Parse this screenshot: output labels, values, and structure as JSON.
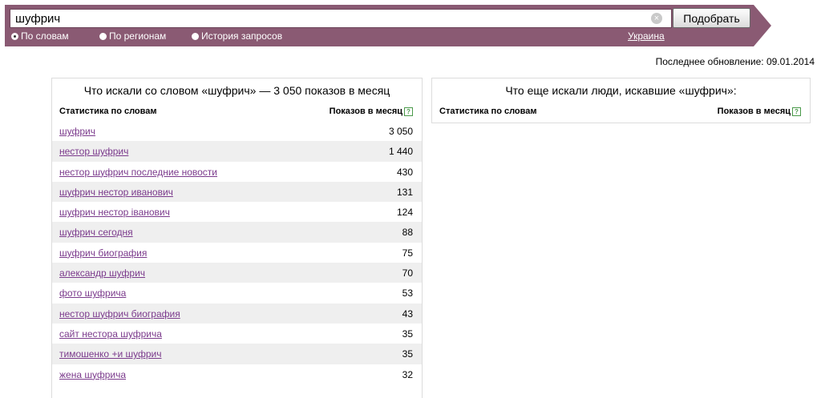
{
  "search": {
    "query": "шуфрич",
    "clear_glyph": "⊗",
    "submit_label": "Подобрать"
  },
  "modes": [
    {
      "label": "По словам",
      "checked": true
    },
    {
      "label": "По регионам",
      "checked": false
    },
    {
      "label": "История запросов",
      "checked": false
    }
  ],
  "region": "Украина",
  "last_update": "Последнее обновление: 09.01.2014",
  "left_panel": {
    "title": "Что искали со словом «шуфрич» — 3 050 показов в месяц",
    "col_words": "Статистика по словам",
    "col_shows": "Показов в месяц",
    "help_glyph": "?",
    "rows": [
      {
        "keyword": "шуфрич",
        "count": "3 050"
      },
      {
        "keyword": "нестор шуфрич",
        "count": "1 440"
      },
      {
        "keyword": "нестор шуфрич последние новости",
        "count": "430"
      },
      {
        "keyword": "шуфрич нестор иванович",
        "count": "131"
      },
      {
        "keyword": "шуфрич нестор іванович",
        "count": "124"
      },
      {
        "keyword": "шуфрич сегодня",
        "count": "88"
      },
      {
        "keyword": "шуфрич биография",
        "count": "75"
      },
      {
        "keyword": "александр шуфрич",
        "count": "70"
      },
      {
        "keyword": "фото шуфрича",
        "count": "53"
      },
      {
        "keyword": "нестор шуфрич биография",
        "count": "43"
      },
      {
        "keyword": "сайт нестора шуфрича",
        "count": "35"
      },
      {
        "keyword": "тимошенко +и шуфрич",
        "count": "35"
      },
      {
        "keyword": "жена шуфрича",
        "count": "32"
      }
    ]
  },
  "right_panel": {
    "title": "Что еще искали люди, искавшие «шуфрич»:",
    "col_words": "Статистика по словам",
    "col_shows": "Показов в месяц",
    "help_glyph": "?"
  },
  "colors": {
    "bar": "#8a5a73",
    "link": "#7b3a8c",
    "row_alt": "#efefef"
  }
}
